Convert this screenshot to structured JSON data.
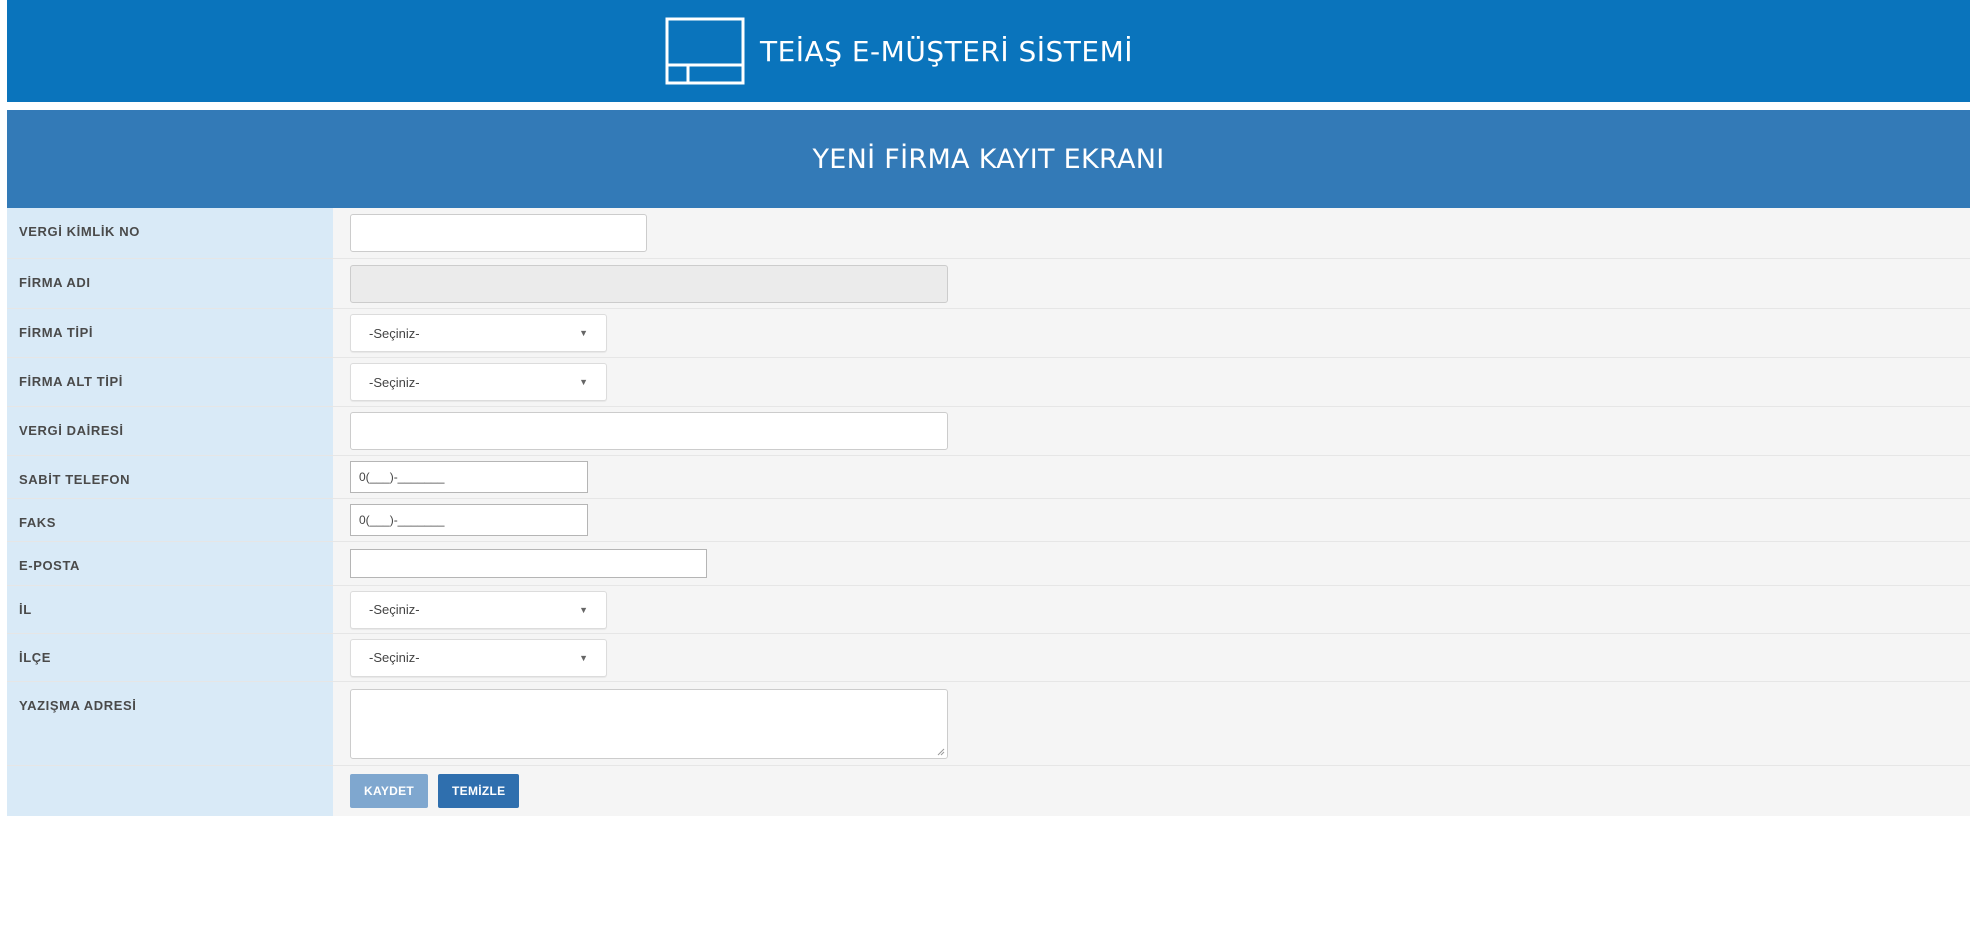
{
  "header": {
    "title": "TEİAŞ E-MÜŞTERİ SİSTEMİ"
  },
  "form": {
    "title": "YENİ FİRMA KAYIT EKRANI",
    "fields": [
      {
        "label": "VERGİ KİMLİK NO",
        "type": "text",
        "value": ""
      },
      {
        "label": "FİRMA ADI",
        "type": "text-disabled",
        "value": ""
      },
      {
        "label": "FİRMA TİPİ",
        "type": "select",
        "value": "-Seçiniz-"
      },
      {
        "label": "FİRMA ALT TİPİ",
        "type": "select",
        "value": "-Seçiniz-"
      },
      {
        "label": "VERGİ DAİRESİ",
        "type": "text",
        "value": ""
      },
      {
        "label": "SABİT TELEFON",
        "type": "phone",
        "value": "0(___)-_______"
      },
      {
        "label": "FAKS",
        "type": "phone",
        "value": "0(___)-_______"
      },
      {
        "label": "E-POSTA",
        "type": "plain",
        "value": ""
      },
      {
        "label": "İL",
        "type": "select",
        "value": "-Seçiniz-"
      },
      {
        "label": "İLÇE",
        "type": "select",
        "value": "-Seçiniz-"
      },
      {
        "label": "YAZIŞMA ADRESİ",
        "type": "textarea",
        "value": ""
      }
    ],
    "buttons": {
      "save_label": "KAYDET",
      "clear_label": "TEMİZLE"
    }
  },
  "icons": {
    "logo": "window-grid-icon",
    "select_caret": "caret-down-icon",
    "resize": "resize-grip-icon"
  },
  "colors": {
    "header_bg": "#0a74bc",
    "title_bar_bg": "#337ab7",
    "label_bg": "#d9eaf7",
    "field_bg": "#f5f5f5",
    "save_button": "#7fa7cf",
    "clear_button": "#2f6fae"
  }
}
